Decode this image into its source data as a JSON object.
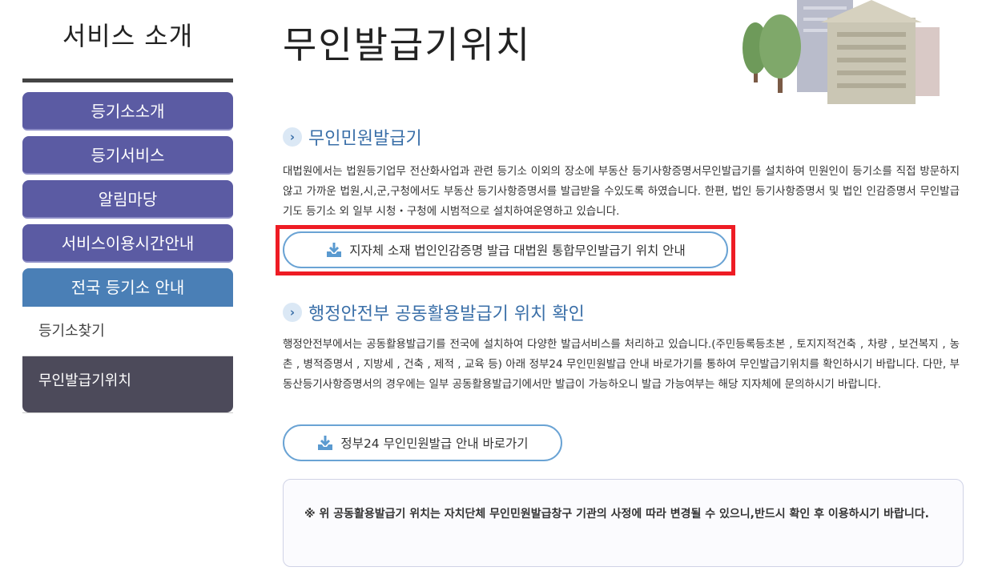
{
  "sidebar": {
    "title": "서비스 소개",
    "menu": [
      {
        "label": "등기소소개"
      },
      {
        "label": "등기서비스"
      },
      {
        "label": "알림마당"
      },
      {
        "label": "서비스이용시간안내"
      },
      {
        "label": "전국 등기소 안내"
      }
    ],
    "submenu": [
      {
        "label": "등기소찾기"
      },
      {
        "label": "무인발급기위치"
      }
    ]
  },
  "page": {
    "title": "무인발급기위치"
  },
  "section1": {
    "title": "무인민원발급기",
    "body": "대법원에서는 법원등기업무 전산화사업과 관련 등기소 이외의 장소에 부동산 등기사항증명서무인발급기를 설치하여 민원인이 등기소를 직접 방문하지 않고 가까운 법원,시,군,구청에서도 부동산 등기사항증명서를 발급받을 수있도록 하였습니다. 한편, 법인 등기사항증명서 및 법인 인감증명서 무인발급기도 등기소 외 일부 시청・구청에 시범적으로 설치하여운영하고 있습니다.",
    "button_label": "지자체 소재 법인인감증명 발급 대법원 통합무인발급기 위치 안내"
  },
  "section2": {
    "title": "행정안전부 공동활용발급기 위치 확인",
    "body": "행정안전부에서는 공동활용발급기를 전국에 설치하여 다양한 발급서비스를 처리하고 있습니다.(주민등록등초본 , 토지지적건축 , 차량 , 보건복지 , 농촌 , 병적증명서 , 지방세 , 건축 , 제적 , 교육 등) 아래 정부24 무인민원발급 안내 바로가기를 통하여 무인발급기위치를 확인하시기 바랍니다. 다만, 부동산등기사항증명서의 경우에는 일부 공동활용발급기에서만 발급이 가능하오니 발급 가능여부는 해당 지자체에 문의하시기 바랍니다.",
    "button_label": "정부24 무인민원발급 안내 바로가기"
  },
  "notice": {
    "text": "※ 위 공동활용발급기 위치는 자치단체 무인민원발급창구 기관의 사정에 따라 변경될 수 있으니,반드시 확인 후 이용하시기 바랍니다."
  },
  "icons": {
    "section_bullet": "chevron-right-icon",
    "button_icon": "download-icon"
  },
  "colors": {
    "menu_bg": "#5b5ba3",
    "menu_active_bg": "#4a7fb6",
    "submenu_selected_bg": "#4c4a5a",
    "accent_blue": "#3a6fa8",
    "pill_border": "#6aa3d4",
    "highlight_red": "#ee1c24"
  }
}
